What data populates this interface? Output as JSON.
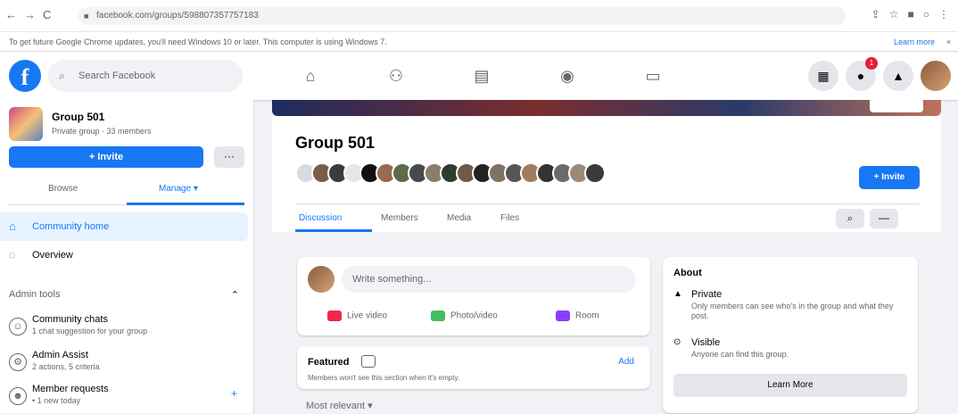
{
  "browser": {
    "url": "facebook.com/groups/598807357757183",
    "back": "←",
    "forward": "→",
    "reload": "C"
  },
  "infobar": {
    "text": "To get future Google Chrome updates, you'll need Windows 10 or later. This computer is using Windows 7.",
    "link": "Learn more",
    "close": "×"
  },
  "top": {
    "search_placeholder": "Search Facebook",
    "logo": "f",
    "badge": "1"
  },
  "group": {
    "name": "Group 501",
    "sub": "Private group · 33 members",
    "invite": "+ Invite",
    "more": "···"
  },
  "sidebar": {
    "tabs": [
      {
        "label": "Browse"
      },
      {
        "label": "Manage ▾"
      }
    ],
    "items": [
      {
        "label": "Community home"
      },
      {
        "label": "Overview"
      }
    ],
    "section": "Admin tools",
    "tools": [
      {
        "title": "Community chats",
        "sub": "1 chat suggestion for your group"
      },
      {
        "title": "Admin Assist",
        "sub": "2 actions, 5 criteria"
      },
      {
        "title": "Member requests",
        "sub": "• 1 new today"
      }
    ]
  },
  "header": {
    "title": "Group 501",
    "invite": "+ Invite",
    "tabs": [
      "Discussion",
      "Members",
      "Media",
      "Files"
    ]
  },
  "composer": {
    "placeholder": "Write something...",
    "actions": [
      "Live video",
      "Photo/video",
      "Room"
    ]
  },
  "featured": {
    "title": "Featured",
    "add": "Add",
    "sub": "Members won't see this section when it's empty."
  },
  "sort": "Most relevant ▾",
  "about": {
    "title": "About",
    "private_title": "Private",
    "private_desc": "Only members can see who's in the group and what they post.",
    "visible_title": "Visible",
    "visible_desc": "Anyone can find this group.",
    "learn": "Learn More"
  },
  "colors": {
    "accent": "#1877f2",
    "bg": "#f0f2f5"
  }
}
